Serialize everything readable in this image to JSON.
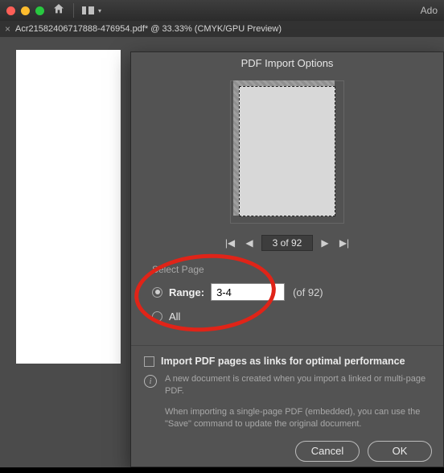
{
  "toolbar": {
    "app_name_fragment": "Ado"
  },
  "document_tab": {
    "close_glyph": "×",
    "title": "Acr21582406717888-476954.pdf* @ 33.33% (CMYK/GPU Preview)"
  },
  "dialog": {
    "title": "PDF Import Options",
    "pager": {
      "first_glyph": "|◀",
      "prev_glyph": "◀",
      "count_text": "3 of 92",
      "next_glyph": "▶",
      "last_glyph": "▶|"
    },
    "select_page": {
      "section_label": "Select Page",
      "range_label": "Range:",
      "range_value": "3-4",
      "of_text": "(of 92)",
      "all_label": "All"
    },
    "link_checkbox_label": "Import PDF pages as links for optimal performance",
    "info": {
      "p1": "A new document is created when you import a linked or multi-page PDF.",
      "p2": "When importing a single-page PDF (embedded), you can use the \"Save\" command to update the original document."
    },
    "buttons": {
      "cancel": "Cancel",
      "ok": "OK"
    }
  }
}
